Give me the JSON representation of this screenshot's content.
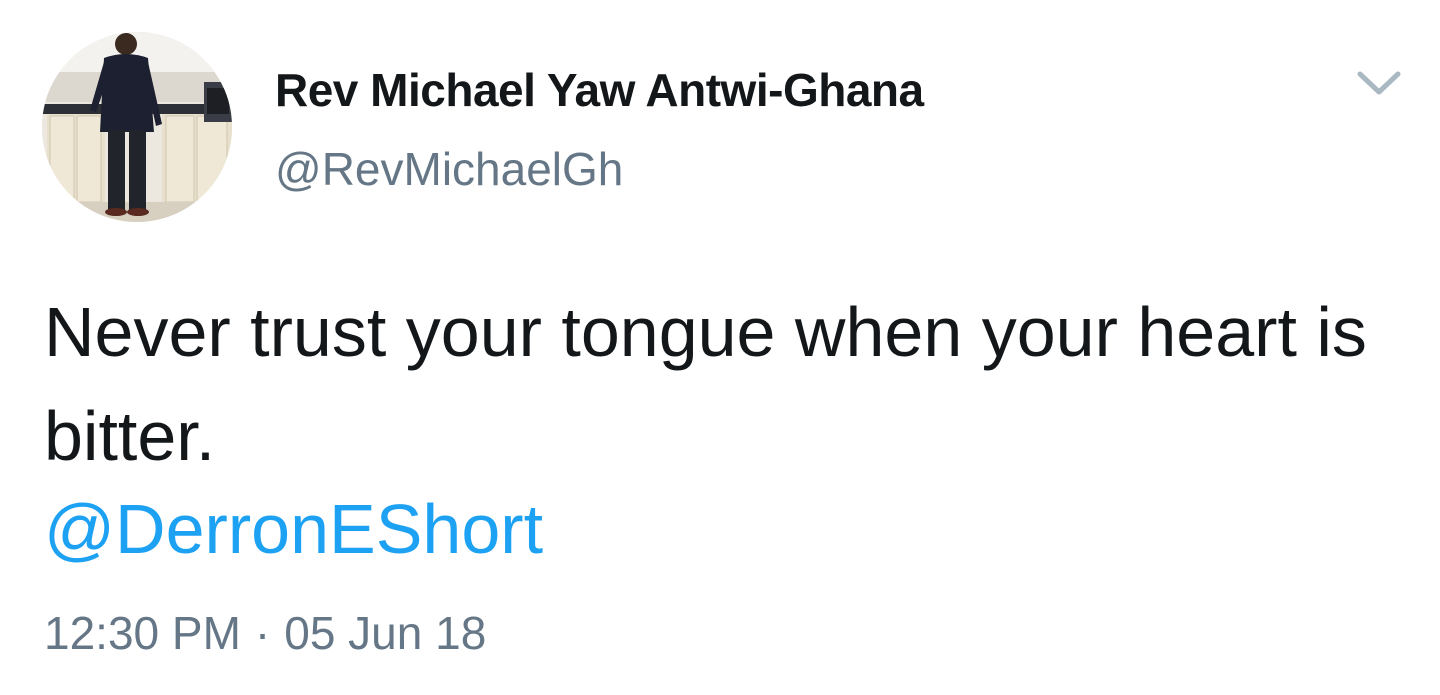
{
  "tweet": {
    "author": {
      "display_name": "Rev Michael Yaw Antwi-Ghana",
      "handle": "@RevMichaelGh"
    },
    "text": "Never trust your tongue when your heart is bitter.",
    "mention": "@DerronEShort",
    "time": "12:30 PM",
    "separator": "·",
    "date": "05 Jun 18",
    "menu_icon": "chevron-down-icon"
  },
  "colors": {
    "text": "#14171a",
    "secondary": "#657786",
    "link": "#1da1f2",
    "caret": "#aab8c2"
  }
}
